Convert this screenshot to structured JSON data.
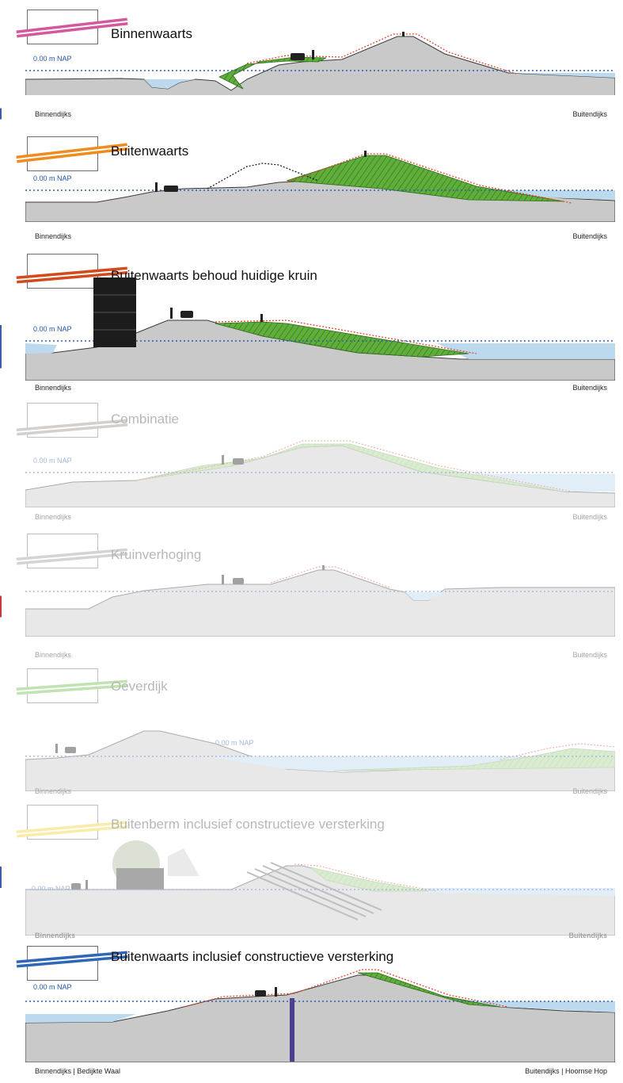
{
  "colors": {
    "ground": "#c9c9c9",
    "ground_edge": "#4a4a4a",
    "water": "#bcd9ee",
    "water_line": "#2f5fb3",
    "reinforcement_fill": "#5fae3a",
    "profile_line": "#e04a2a"
  },
  "nap_label": "0.00 m NAP",
  "panels": [
    {
      "id": "binnenwaarts",
      "title": "Binnenwaarts",
      "legend_color": "#d3589e",
      "legend_icon": "pink-stripe-icon",
      "nap_label": "0.00 m NAP",
      "left_label": "Binnendijks",
      "right_label": "Buitendijks"
    },
    {
      "id": "buitenwaarts",
      "title": "Buitenwaarts",
      "legend_color": "#f08c1f",
      "legend_icon": "orange-stripe-icon",
      "nap_label": "0.00 m NAP",
      "left_label": "Binnendijks",
      "right_label": "Buitendijks"
    },
    {
      "id": "buitenwaarts-behoud",
      "title": "Buitenwaarts behoud huidige kruin",
      "legend_color": "#d34a1c",
      "legend_icon": "red-stripe-icon",
      "nap_label": "0.00 m NAP",
      "left_label": "Binnendijks",
      "right_label": "Buitendijks"
    },
    {
      "id": "combinatie",
      "title": "Combinatie",
      "legend_color": "#9b8f84",
      "legend_icon": "taupe-stripe-icon",
      "nap_label": "0.00 m NAP",
      "left_label": "Binnendijks",
      "right_label": "Buitendijks"
    },
    {
      "id": "kruinverhoging",
      "title": "Kruinverhoging",
      "legend_color": "#9a9a9a",
      "legend_icon": "grey-stripe-icon",
      "nap_label": "",
      "left_label": "Binnendijks",
      "right_label": "Buitendijks"
    },
    {
      "id": "oeverdijk",
      "title": "Oeverdijk",
      "legend_color": "#6bc048",
      "legend_icon": "green-stripe-icon",
      "nap_label": "0.00 m NAP",
      "left_label": "Binnendijks",
      "right_label": "Buitendijks"
    },
    {
      "id": "buitenberm",
      "title": "Buitenberm inclusief constructieve versterking",
      "legend_color": "#f2d33a",
      "legend_icon": "yellow-stripe-icon",
      "nap_label": "0.00 m NAP",
      "left_label": "Binnendijks",
      "right_label": "Buitendijks"
    },
    {
      "id": "buitenwaarts-constructief",
      "title": "Buitenwaarts inclusief constructieve versterking",
      "legend_color": "#2f66b8",
      "legend_icon": "blue-stripe-icon",
      "nap_label": "0.00 m NAP",
      "left_label": "Binnendijks | Bedijkte Waal",
      "right_label": "Buitendijks | Hoornse Hop"
    }
  ]
}
